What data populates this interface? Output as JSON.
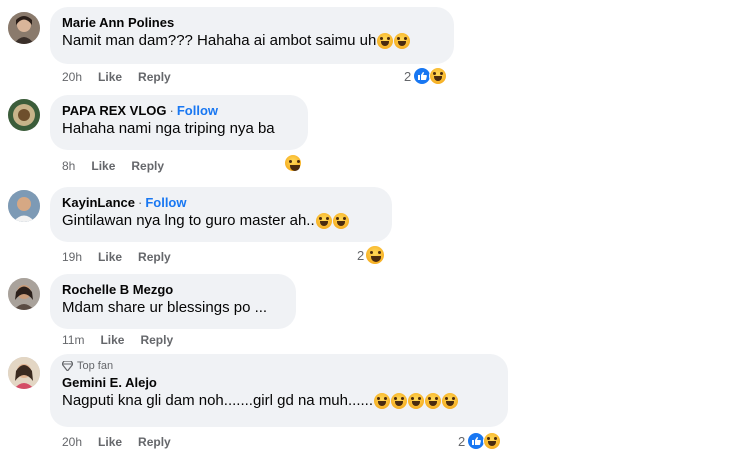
{
  "comments": [
    {
      "name": "Marie Ann Polines",
      "text": "Namit man dam??? Hahaha ai ambot saimu uh",
      "time": "20h",
      "like": "Like",
      "reply": "Reply",
      "reaction_count": "2",
      "emoji": "laughing-tears"
    },
    {
      "name": "PAPA REX VLOG",
      "follow": "Follow",
      "text": "Hahaha nami nga triping nya ba",
      "time": "8h",
      "like": "Like",
      "reply": "Reply",
      "emoji": "laughing"
    },
    {
      "name": "KayinLance",
      "follow": "Follow",
      "text": "Gintilawan nya lng to guro master ah..",
      "time": "19h",
      "like": "Like",
      "reply": "Reply",
      "reaction_count": "2",
      "emoji": "laughing"
    },
    {
      "name": "Rochelle B Mezgo",
      "text": "Mdam share ur blessings po ...",
      "time": "11m",
      "like": "Like",
      "reply": "Reply"
    },
    {
      "badge": "Top fan",
      "name": "Gemini E. Alejo",
      "text": "Nagputi kna gli dam noh.......girl gd na muh......",
      "time": "20h",
      "like": "Like",
      "reply": "Reply",
      "reaction_count": "2",
      "emoji": "rolling-on-floor-laughing"
    }
  ],
  "colors": {
    "bubble": "#f0f2f5",
    "link": "#1877f2",
    "meta": "#65676b"
  }
}
